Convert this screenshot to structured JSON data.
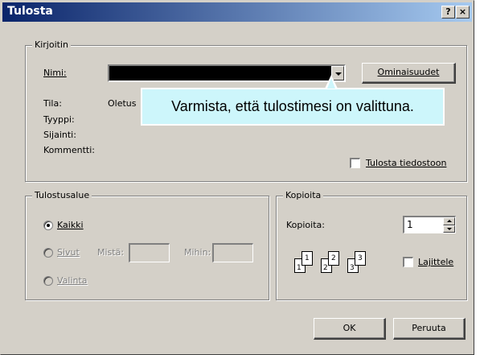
{
  "window": {
    "title": "Tulosta",
    "help_btn": "?",
    "close_btn": "×"
  },
  "printer": {
    "group_label": "Kirjoitin",
    "name_label": "Nimi:",
    "properties_button": "Ominaisuudet",
    "status_label": "Tila:",
    "status_value": "Oletus",
    "type_label": "Tyyppi:",
    "location_label": "Sijainti:",
    "comment_label": "Kommentti:",
    "print_to_file_label": "Tulosta tiedostoon"
  },
  "range": {
    "group_label": "Tulostusalue",
    "all_label": "Kaikki",
    "pages_label": "Sivut",
    "from_label": "Mistä:",
    "to_label": "Mihin:",
    "selection_label": "Valinta",
    "selected": "all"
  },
  "copies": {
    "group_label": "Kopioita",
    "count_label": "Kopioita:",
    "count_value": "1",
    "collate_label": "Lajittele",
    "page_numbers": [
      "1",
      "1",
      "2",
      "2",
      "3",
      "3"
    ]
  },
  "buttons": {
    "ok": "OK",
    "cancel": "Peruuta"
  },
  "callout": {
    "text": "Varmista, että tulostimesi on valittuna."
  }
}
